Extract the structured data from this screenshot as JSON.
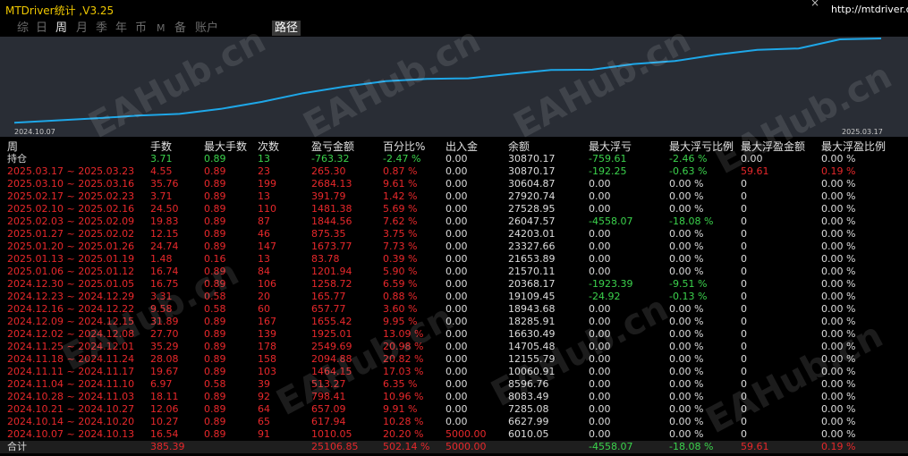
{
  "window": {
    "title": "MTDriver统计 ,V3.25",
    "url": "http://mtdriver.com",
    "close_symbol": "×"
  },
  "tabs": [
    {
      "label": "综",
      "active": false
    },
    {
      "label": "日",
      "active": false
    },
    {
      "label": "周",
      "active": true
    },
    {
      "label": "月",
      "active": false
    },
    {
      "label": "季",
      "active": false
    },
    {
      "label": "年",
      "active": false
    },
    {
      "label": "币",
      "active": false
    },
    {
      "label": "M",
      "active": false
    },
    {
      "label": "备",
      "active": false
    },
    {
      "label": "账户",
      "active": false
    }
  ],
  "path_tab": "路径",
  "equity_chart": {
    "start_label": "2024.10.07",
    "end_label": "2025.03.17",
    "line_color": "#1ea7e8",
    "background": "#292d35",
    "balance_series": [
      6010.05,
      6627.99,
      7285.08,
      8083.49,
      8596.76,
      10060.91,
      12155.79,
      14705.48,
      16630.49,
      18285.91,
      18943.68,
      19109.45,
      20368.17,
      21570.11,
      21653.89,
      23327.66,
      24203.01,
      26047.57,
      27528.95,
      27920.74,
      30604.87,
      30870.17
    ]
  },
  "watermark": "EAHub.cn",
  "table": {
    "headers": [
      "周",
      "手数",
      "最大手数",
      "次数",
      "盈亏金额",
      "百分比%",
      "出入金",
      "余额",
      "最大浮亏",
      "最大浮亏比例",
      "最大浮盈金额",
      "最大浮盈比例"
    ],
    "holding": {
      "label": "持仓",
      "lots": "3.71",
      "max_lots": "0.89",
      "count": "13",
      "pnl": "-763.32",
      "pct": "-2.47 %",
      "deposit": "0.00",
      "balance": "30870.17",
      "max_dd": "-759.61",
      "max_dd_pct": "-2.46 %",
      "max_fp": "0.00",
      "max_fp_pct": "0.00 %"
    },
    "rows": [
      {
        "period": "2025.03.17 ~ 2025.03.23",
        "lots": "4.55",
        "max_lots": "0.89",
        "count": "23",
        "pnl": "265.30",
        "pct": "0.87 %",
        "deposit": "0.00",
        "balance": "30870.17",
        "max_dd": "-192.25",
        "max_dd_pct": "-0.63 %",
        "max_fp": "59.61",
        "max_fp_pct": "0.19 %"
      },
      {
        "period": "2025.03.10 ~ 2025.03.16",
        "lots": "35.76",
        "max_lots": "0.89",
        "count": "199",
        "pnl": "2684.13",
        "pct": "9.61 %",
        "deposit": "0.00",
        "balance": "30604.87",
        "max_dd": "0.00",
        "max_dd_pct": "0.00 %",
        "max_fp": "0",
        "max_fp_pct": "0.00 %"
      },
      {
        "period": "2025.02.17 ~ 2025.02.23",
        "lots": "3.71",
        "max_lots": "0.89",
        "count": "13",
        "pnl": "391.79",
        "pct": "1.42 %",
        "deposit": "0.00",
        "balance": "27920.74",
        "max_dd": "0.00",
        "max_dd_pct": "0.00 %",
        "max_fp": "0",
        "max_fp_pct": "0.00 %"
      },
      {
        "period": "2025.02.10 ~ 2025.02.16",
        "lots": "24.50",
        "max_lots": "0.89",
        "count": "110",
        "pnl": "1481.38",
        "pct": "5.69 %",
        "deposit": "0.00",
        "balance": "27528.95",
        "max_dd": "0.00",
        "max_dd_pct": "0.00 %",
        "max_fp": "0",
        "max_fp_pct": "0.00 %"
      },
      {
        "period": "2025.02.03 ~ 2025.02.09",
        "lots": "19.83",
        "max_lots": "0.89",
        "count": "87",
        "pnl": "1844.56",
        "pct": "7.62 %",
        "deposit": "0.00",
        "balance": "26047.57",
        "max_dd": "-4558.07",
        "max_dd_pct": "-18.08 %",
        "max_fp": "0",
        "max_fp_pct": "0.00 %"
      },
      {
        "period": "2025.01.27 ~ 2025.02.02",
        "lots": "12.15",
        "max_lots": "0.89",
        "count": "46",
        "pnl": "875.35",
        "pct": "3.75 %",
        "deposit": "0.00",
        "balance": "24203.01",
        "max_dd": "0.00",
        "max_dd_pct": "0.00 %",
        "max_fp": "0",
        "max_fp_pct": "0.00 %"
      },
      {
        "period": "2025.01.20 ~ 2025.01.26",
        "lots": "24.74",
        "max_lots": "0.89",
        "count": "147",
        "pnl": "1673.77",
        "pct": "7.73 %",
        "deposit": "0.00",
        "balance": "23327.66",
        "max_dd": "0.00",
        "max_dd_pct": "0.00 %",
        "max_fp": "0",
        "max_fp_pct": "0.00 %"
      },
      {
        "period": "2025.01.13 ~ 2025.01.19",
        "lots": "1.48",
        "max_lots": "0.16",
        "count": "13",
        "pnl": "83.78",
        "pct": "0.39 %",
        "deposit": "0.00",
        "balance": "21653.89",
        "max_dd": "0.00",
        "max_dd_pct": "0.00 %",
        "max_fp": "0",
        "max_fp_pct": "0.00 %"
      },
      {
        "period": "2025.01.06 ~ 2025.01.12",
        "lots": "16.74",
        "max_lots": "0.89",
        "count": "84",
        "pnl": "1201.94",
        "pct": "5.90 %",
        "deposit": "0.00",
        "balance": "21570.11",
        "max_dd": "0.00",
        "max_dd_pct": "0.00 %",
        "max_fp": "0",
        "max_fp_pct": "0.00 %"
      },
      {
        "period": "2024.12.30 ~ 2025.01.05",
        "lots": "16.75",
        "max_lots": "0.89",
        "count": "106",
        "pnl": "1258.72",
        "pct": "6.59 %",
        "deposit": "0.00",
        "balance": "20368.17",
        "max_dd": "-1923.39",
        "max_dd_pct": "-9.51 %",
        "max_fp": "0",
        "max_fp_pct": "0.00 %"
      },
      {
        "period": "2024.12.23 ~ 2024.12.29",
        "lots": "3.31",
        "max_lots": "0.58",
        "count": "20",
        "pnl": "165.77",
        "pct": "0.88 %",
        "deposit": "0.00",
        "balance": "19109.45",
        "max_dd": "-24.92",
        "max_dd_pct": "-0.13 %",
        "max_fp": "0",
        "max_fp_pct": "0.00 %"
      },
      {
        "period": "2024.12.16 ~ 2024.12.22",
        "lots": "9.58",
        "max_lots": "0.58",
        "count": "60",
        "pnl": "657.77",
        "pct": "3.60 %",
        "deposit": "0.00",
        "balance": "18943.68",
        "max_dd": "0.00",
        "max_dd_pct": "0.00 %",
        "max_fp": "0",
        "max_fp_pct": "0.00 %"
      },
      {
        "period": "2024.12.09 ~ 2024.12.15",
        "lots": "31.89",
        "max_lots": "0.89",
        "count": "167",
        "pnl": "1655.42",
        "pct": "9.95 %",
        "deposit": "0.00",
        "balance": "18285.91",
        "max_dd": "0.00",
        "max_dd_pct": "0.00 %",
        "max_fp": "0",
        "max_fp_pct": "0.00 %"
      },
      {
        "period": "2024.12.02 ~ 2024.12.08",
        "lots": "27.70",
        "max_lots": "0.89",
        "count": "139",
        "pnl": "1925.01",
        "pct": "13.09 %",
        "deposit": "0.00",
        "balance": "16630.49",
        "max_dd": "0.00",
        "max_dd_pct": "0.00 %",
        "max_fp": "0",
        "max_fp_pct": "0.00 %"
      },
      {
        "period": "2024.11.25 ~ 2024.12.01",
        "lots": "35.29",
        "max_lots": "0.89",
        "count": "178",
        "pnl": "2549.69",
        "pct": "20.98 %",
        "deposit": "0.00",
        "balance": "14705.48",
        "max_dd": "0.00",
        "max_dd_pct": "0.00 %",
        "max_fp": "0",
        "max_fp_pct": "0.00 %"
      },
      {
        "period": "2024.11.18 ~ 2024.11.24",
        "lots": "28.08",
        "max_lots": "0.89",
        "count": "158",
        "pnl": "2094.88",
        "pct": "20.82 %",
        "deposit": "0.00",
        "balance": "12155.79",
        "max_dd": "0.00",
        "max_dd_pct": "0.00 %",
        "max_fp": "0",
        "max_fp_pct": "0.00 %"
      },
      {
        "period": "2024.11.11 ~ 2024.11.17",
        "lots": "19.67",
        "max_lots": "0.89",
        "count": "103",
        "pnl": "1464.15",
        "pct": "17.03 %",
        "deposit": "0.00",
        "balance": "10060.91",
        "max_dd": "0.00",
        "max_dd_pct": "0.00 %",
        "max_fp": "0",
        "max_fp_pct": "0.00 %"
      },
      {
        "period": "2024.11.04 ~ 2024.11.10",
        "lots": "6.97",
        "max_lots": "0.58",
        "count": "39",
        "pnl": "513.27",
        "pct": "6.35 %",
        "deposit": "0.00",
        "balance": "8596.76",
        "max_dd": "0.00",
        "max_dd_pct": "0.00 %",
        "max_fp": "0",
        "max_fp_pct": "0.00 %"
      },
      {
        "period": "2024.10.28 ~ 2024.11.03",
        "lots": "18.11",
        "max_lots": "0.89",
        "count": "92",
        "pnl": "798.41",
        "pct": "10.96 %",
        "deposit": "0.00",
        "balance": "8083.49",
        "max_dd": "0.00",
        "max_dd_pct": "0.00 %",
        "max_fp": "0",
        "max_fp_pct": "0.00 %"
      },
      {
        "period": "2024.10.21 ~ 2024.10.27",
        "lots": "12.06",
        "max_lots": "0.89",
        "count": "64",
        "pnl": "657.09",
        "pct": "9.91 %",
        "deposit": "0.00",
        "balance": "7285.08",
        "max_dd": "0.00",
        "max_dd_pct": "0.00 %",
        "max_fp": "0",
        "max_fp_pct": "0.00 %"
      },
      {
        "period": "2024.10.14 ~ 2024.10.20",
        "lots": "10.27",
        "max_lots": "0.89",
        "count": "65",
        "pnl": "617.94",
        "pct": "10.28 %",
        "deposit": "0.00",
        "balance": "6627.99",
        "max_dd": "0.00",
        "max_dd_pct": "0.00 %",
        "max_fp": "0",
        "max_fp_pct": "0.00 %"
      },
      {
        "period": "2024.10.07 ~ 2024.10.13",
        "lots": "16.54",
        "max_lots": "0.89",
        "count": "91",
        "pnl": "1010.05",
        "pct": "20.20 %",
        "deposit": "5000.00",
        "balance": "6010.05",
        "max_dd": "0.00",
        "max_dd_pct": "0.00 %",
        "max_fp": "0",
        "max_fp_pct": "0.00 %"
      }
    ],
    "total": {
      "label": "合计",
      "lots": "385.39",
      "max_lots": "",
      "count": "",
      "pnl": "25106.85",
      "pct": "502.14 %",
      "deposit": "5000.00",
      "balance": "",
      "max_dd": "-4558.07",
      "max_dd_pct": "-18.08 %",
      "max_fp": "59.61",
      "max_fp_pct": "0.19 %"
    }
  }
}
